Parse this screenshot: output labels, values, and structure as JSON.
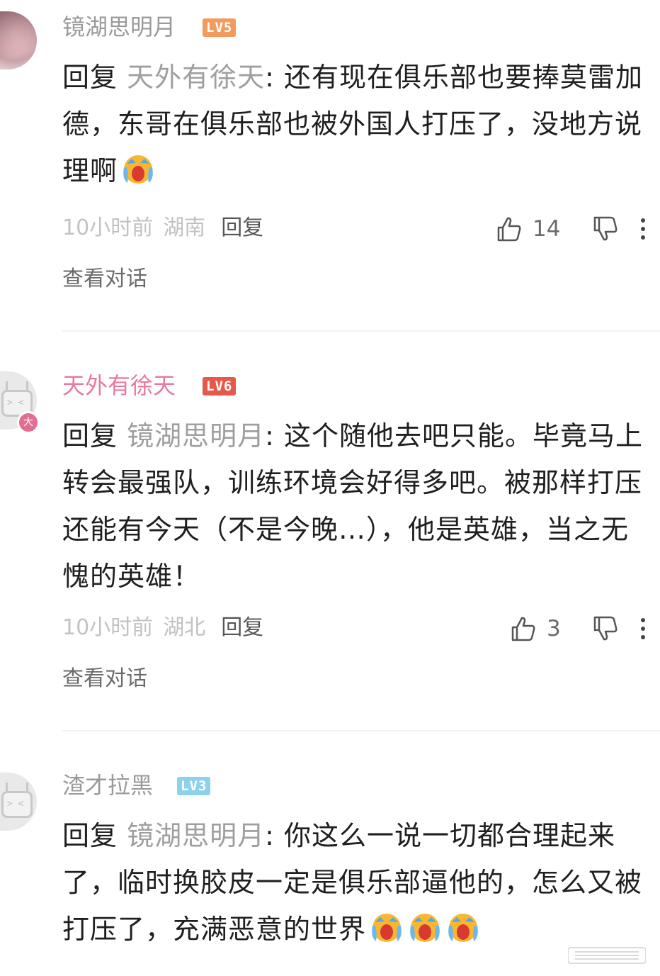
{
  "comments": [
    {
      "username": "镜湖思明月",
      "level": "LV5",
      "reply_prefix": "回复 ",
      "reply_target": "天外有徐天",
      "reply_colon": ": ",
      "text": "还有现在俱乐部也要捧莫雷加德，东哥在俱乐部也被外国人打压了，没地方说理啊",
      "emojis": [
        "crying-emoji"
      ],
      "time": "10小时前",
      "location": "湖南",
      "reply_label": "回复",
      "likes": "14",
      "view_conversation": "查看对话"
    },
    {
      "username": "天外有徐天",
      "level": "LV6",
      "avatar_badge": "大",
      "reply_prefix": "回复 ",
      "reply_target": "镜湖思明月",
      "reply_colon": ": ",
      "text": "这个随他去吧只能。毕竟马上转会最强队，训练环境会好得多吧。被那样打压还能有今天（不是今晚…），他是英雄，当之无愧的英雄！",
      "emojis": [],
      "time": "10小时前",
      "location": "湖北",
      "reply_label": "回复",
      "likes": "3",
      "view_conversation": "查看对话"
    },
    {
      "username": "渣才拉黑",
      "level": "LV3",
      "reply_prefix": "回复 ",
      "reply_target": "镜湖思明月",
      "reply_colon": ": ",
      "text": "你这么一说一切都合理起来了，临时换胶皮一定是俱乐部逼他的，怎么又被打压了，充满恶意的世界",
      "emojis": [
        "crying-emoji",
        "crying-emoji",
        "crying-emoji"
      ]
    }
  ],
  "colors": {
    "username_gray": "#9a9a9a",
    "username_pink": "#e8799f",
    "lv5": "#f39a5e",
    "lv6": "#e5584a",
    "lv3": "#8dd2ec"
  }
}
